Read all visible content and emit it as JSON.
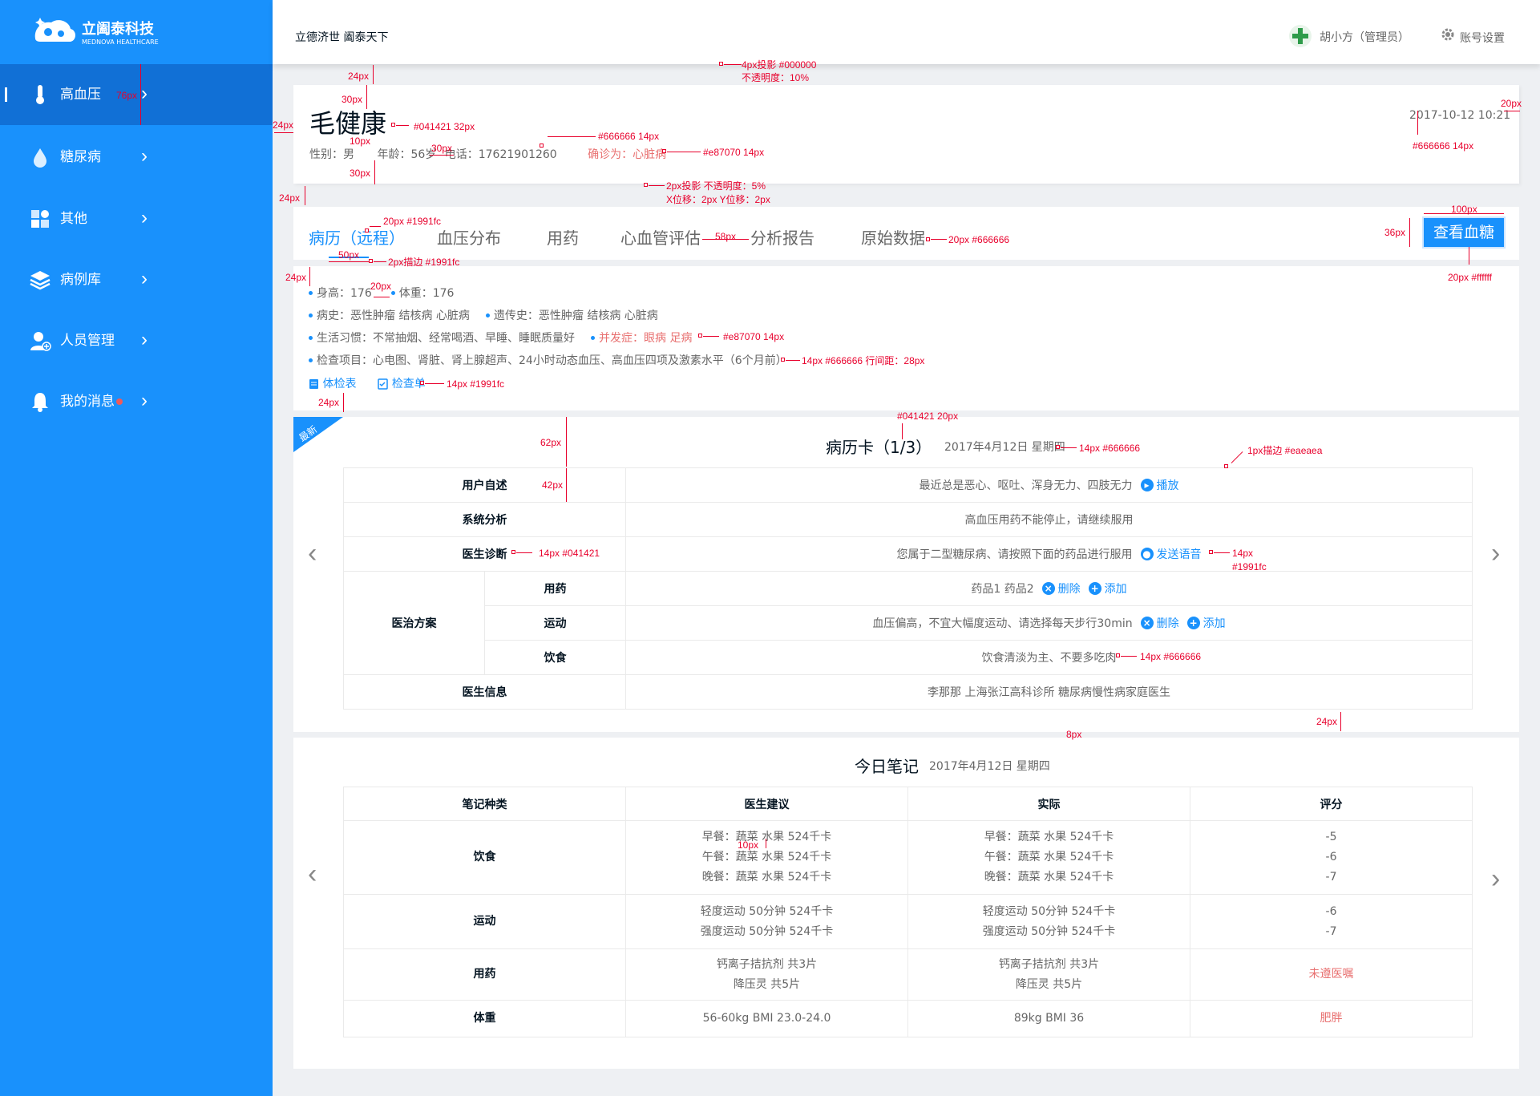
{
  "brand": {
    "name": "立阖泰科技",
    "sub": "MEDNOVA HEALTHCARE"
  },
  "sidebar": {
    "items": [
      {
        "label": "高血压",
        "icon": "thermometer-icon",
        "active": true
      },
      {
        "label": "糖尿病",
        "icon": "drop-icon"
      },
      {
        "label": "其他",
        "icon": "grid-icon"
      },
      {
        "label": "病例库",
        "icon": "layers-icon"
      },
      {
        "label": "人员管理",
        "icon": "user-add-icon"
      },
      {
        "label": "我的消息",
        "icon": "bell-icon",
        "badge": true
      }
    ]
  },
  "topbar": {
    "slogan": "立德济世  阖泰天下",
    "user": "胡小方（管理员）",
    "settings": "账号设置"
  },
  "patient": {
    "name": "毛健康",
    "gender": "性别：男",
    "age": "年龄：56岁",
    "phone": "电话：17621901260",
    "diagnosis": "确诊为：心脏病",
    "datetime": "2017-10-12 10:21"
  },
  "tabs": [
    "病历（远程）",
    "血压分布",
    "用药",
    "心血管评估",
    "分析报告",
    "原始数据"
  ],
  "view_glucose": "查看血糖",
  "info": {
    "height": "身高：176",
    "weight": "体重：176",
    "history": "病史：恶性肿瘤   结核病   心脏病",
    "genetic": "遗传史：恶性肿瘤   结核病   心脏病",
    "habits": "生活习惯：不常抽烟、经常喝酒、早睡、睡眠质量好",
    "complication": "并发症：眼病  足病",
    "exams": "检查项目：心电图、肾脏、肾上腺超声、24小时动态血压、高血压四项及激素水平（6个月前）",
    "link1": "体检表",
    "link2": "检查单"
  },
  "record": {
    "ribbon": "最新",
    "title": "病历卡（1/3）",
    "date": "2017年4月12日  星期四",
    "rows": {
      "complaint_label": "用户自述",
      "complaint": "最近总是恶心、呕吐、浑身无力、四肢无力",
      "play": "播放",
      "analysis_label": "系统分析",
      "analysis": "高血压用药不能停止，请继续服用",
      "diagnosis_label": "医生诊断",
      "diagnosis": "您属于二型糖尿病、请按照下面的药品进行服用",
      "voice": "发送语音",
      "plan_label": "医治方案",
      "med_label": "用药",
      "med": "药品1    药品2",
      "exercise_label": "运动",
      "exercise": "血压偏高，不宜大幅度运动、请选择每天步行30min",
      "diet_label": "饮食",
      "diet": "饮食清淡为主、不要多吃肉",
      "delete": "删除",
      "add": "添加",
      "doctor_label": "医生信息",
      "doctor": "李那那        上海张江高科诊所    糖尿病慢性病家庭医生"
    }
  },
  "notes": {
    "title": "今日笔记",
    "date": "2017年4月12日  星期四",
    "headers": [
      "笔记种类",
      "医生建议",
      "实际",
      "评分"
    ],
    "diet_label": "饮食",
    "diet_lines": [
      "早餐：蔬菜  水果  524千卡",
      "午餐：蔬菜  水果  524千卡",
      "晚餐：蔬菜  水果  524千卡"
    ],
    "diet_scores": [
      "-5",
      "-6",
      "-7"
    ],
    "exercise_label": "运动",
    "exercise_lines": [
      "轻度运动  50分钟  524千卡",
      "强度运动  50分钟  524千卡"
    ],
    "exercise_scores": [
      "-6",
      "-7"
    ],
    "med_label": "用药",
    "med_lines": [
      "钙离子拮抗剂      共3片",
      "降压灵               共5片"
    ],
    "med_score": "未遵医嘱",
    "weight_label": "体重",
    "weight_advice": "56-60kg  BMI 23.0-24.0",
    "weight_actual": "89kg  BMI 36",
    "weight_score": "肥胖"
  },
  "annotations": {
    "a24_1": "24px",
    "a4px": "4px投影 #000000",
    "a4px2": "不透明度：10%",
    "a76": "76px",
    "a30_1": "30px",
    "a24_2": "24px",
    "aname": "#041421 32px",
    "a10": "10px",
    "a30_2": "30px",
    "a666": "#666666 14px",
    "ae87": "#e87070 14px",
    "a30_3": "30px",
    "a20": "20px",
    "a666b": "#666666 14px",
    "a24_3": "24px",
    "a2px": "2px投影 不透明度：5%",
    "a2px2": "X位移：2px   Y位移：2px",
    "a20px": "20px #1991fc",
    "a58": "58px",
    "a20666": "20px #666666",
    "a100": "100px",
    "a36": "36px",
    "a50": "50px",
    "astroke": "2px描边 #1991fc",
    "a24_4": "24px",
    "a20fff": "20px #ffffff",
    "a20_2": "20px",
    "ae87b": "#e87070 14px",
    "aline": "14px #666666 行间距：28px",
    "alink": "14px #1991fc",
    "a24_5": "24px",
    "atitle": "#041421 20px",
    "a62": "62px",
    "adate": "14px #666666",
    "aborder": "1px描边 #eaeaea",
    "a42": "42px",
    "alab": "14px #041421",
    "avoice": "14px",
    "avoice2": "#1991fc",
    "adiet": "14px #666666",
    "a24_6": "24px",
    "a8": "8px",
    "a10_2": "10px"
  }
}
